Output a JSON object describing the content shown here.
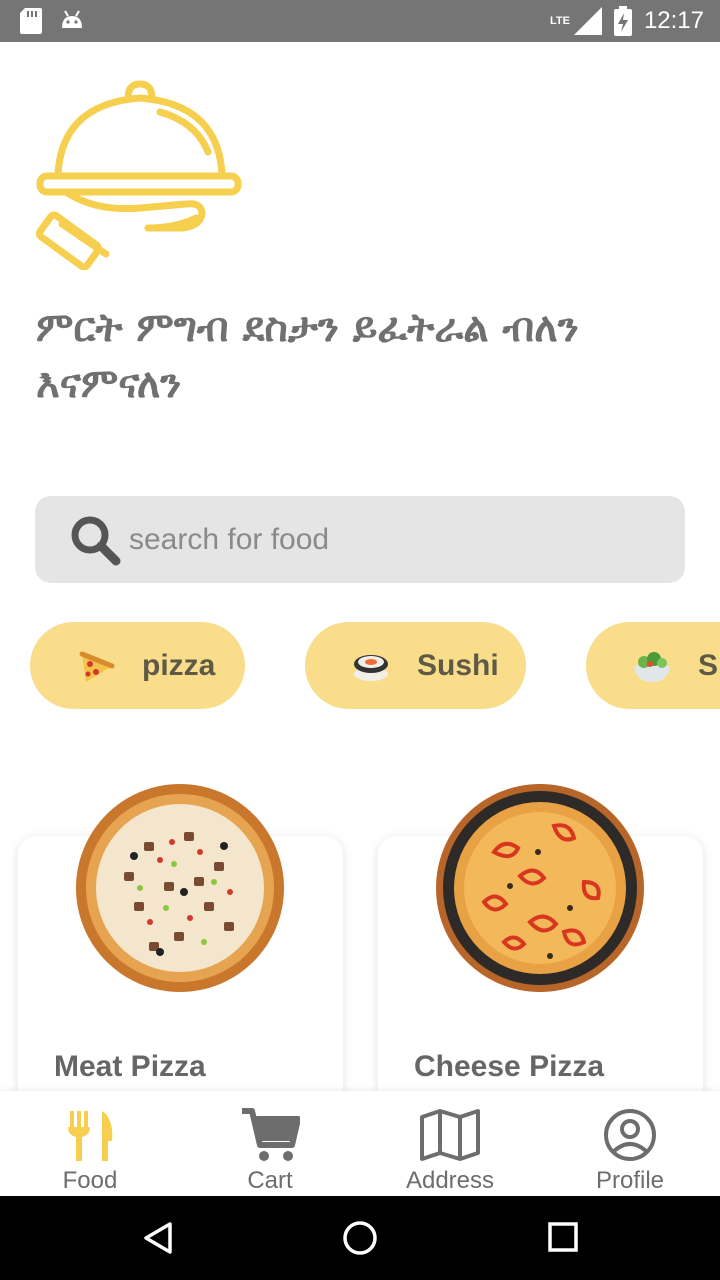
{
  "status_bar": {
    "time": "12:17",
    "network": "LTE"
  },
  "tagline": "ምርት ምግብ ደስታን ይፈትራል ብለን እናምናለን",
  "search": {
    "placeholder": "search for food"
  },
  "categories": [
    {
      "label": "pizza",
      "icon": "pizza-emoji"
    },
    {
      "label": "Sushi",
      "icon": "sushi-emoji"
    },
    {
      "label": "S",
      "icon": "salad-emoji"
    }
  ],
  "foods": [
    {
      "name": "Meat Pizza"
    },
    {
      "name": "Cheese Pizza"
    }
  ],
  "nav": [
    {
      "label": "Food",
      "icon": "fork-knife-icon",
      "active": true
    },
    {
      "label": "Cart",
      "icon": "cart-icon",
      "active": false
    },
    {
      "label": "Address",
      "icon": "map-icon",
      "active": false
    },
    {
      "label": "Profile",
      "icon": "profile-icon",
      "active": false
    }
  ],
  "colors": {
    "accent": "#f7cf4f",
    "chip": "#f9dd8b",
    "text_gray": "#707070",
    "search_bg": "#e5e5e5"
  }
}
